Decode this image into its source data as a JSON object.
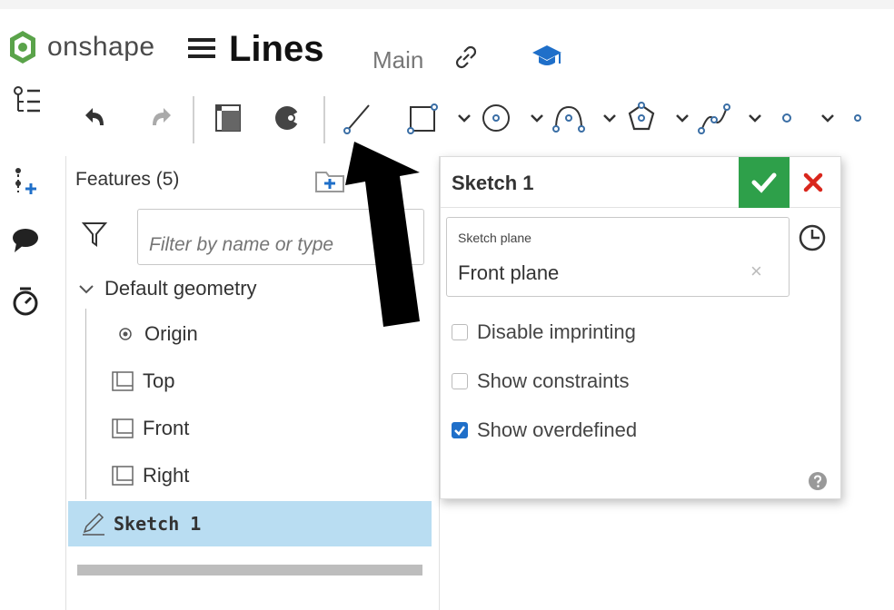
{
  "header": {
    "logo_text": "onshape",
    "document_title": "Lines",
    "branch": "Main"
  },
  "features": {
    "header": "Features (5)",
    "filter_placeholder": "Filter by name or type",
    "group_label": "Default geometry",
    "items": [
      "Origin",
      "Top",
      "Front",
      "Right"
    ],
    "selected_feature": "Sketch 1"
  },
  "sketch_dialog": {
    "title": "Sketch 1",
    "plane_label": "Sketch plane",
    "plane_value": "Front plane",
    "clear_glyph": "×",
    "options": [
      {
        "label": "Disable imprinting",
        "checked": false
      },
      {
        "label": "Show constraints",
        "checked": false
      },
      {
        "label": "Show overdefined",
        "checked": true
      }
    ]
  },
  "colors": {
    "accept": "#2ea04a",
    "cancel": "#d9261c",
    "selection": "#b9ddf2",
    "checkbox": "#1f6fc9",
    "tool_stroke": "#3a6ea5"
  }
}
